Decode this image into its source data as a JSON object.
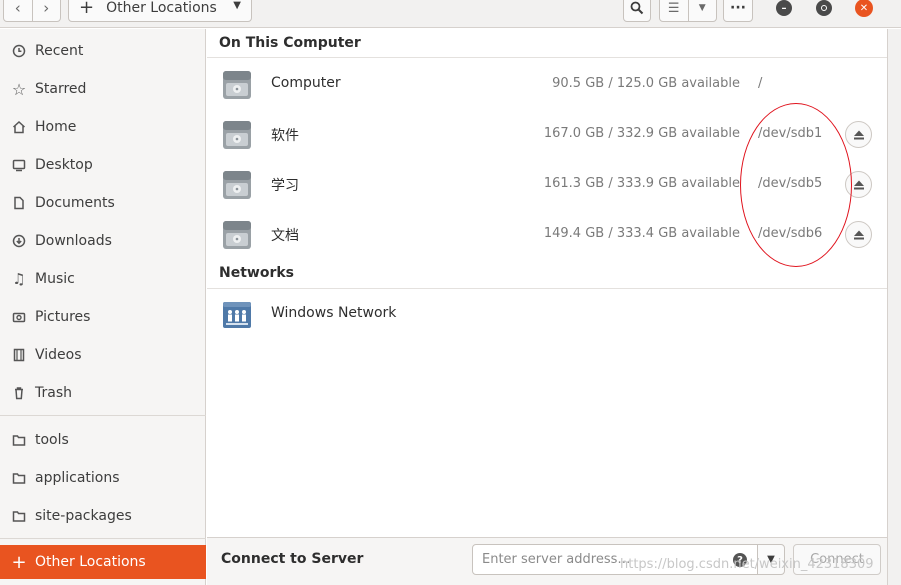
{
  "header": {
    "location_label": "Other Locations"
  },
  "sidebar": {
    "items": [
      {
        "label": "Recent",
        "icon": "clock-icon"
      },
      {
        "label": "Starred",
        "icon": "star-icon"
      },
      {
        "label": "Home",
        "icon": "home-icon"
      },
      {
        "label": "Desktop",
        "icon": "desktop-icon"
      },
      {
        "label": "Documents",
        "icon": "document-icon"
      },
      {
        "label": "Downloads",
        "icon": "download-icon"
      },
      {
        "label": "Music",
        "icon": "music-icon"
      },
      {
        "label": "Pictures",
        "icon": "camera-icon"
      },
      {
        "label": "Videos",
        "icon": "film-icon"
      },
      {
        "label": "Trash",
        "icon": "trash-icon"
      }
    ],
    "bookmarks": [
      {
        "label": "tools",
        "icon": "folder-icon"
      },
      {
        "label": "applications",
        "icon": "folder-icon"
      },
      {
        "label": "site-packages",
        "icon": "folder-icon"
      }
    ],
    "other_locations_label": "Other Locations",
    "accent_color": "#e95420"
  },
  "main": {
    "on_this_computer_title": "On This Computer",
    "drives": [
      {
        "name": "Computer",
        "space": "90.5 GB / 125.0 GB available",
        "mount": "/",
        "ejectable": false
      },
      {
        "name": "软件",
        "space": "167.0 GB / 332.9 GB available",
        "mount": "/dev/sdb1",
        "ejectable": true
      },
      {
        "name": "学习",
        "space": "161.3 GB / 333.9 GB available",
        "mount": "/dev/sdb5",
        "ejectable": true
      },
      {
        "name": "文档",
        "space": "149.4 GB / 333.4 GB available",
        "mount": "/dev/sdb6",
        "ejectable": true
      }
    ],
    "networks_title": "Networks",
    "networks": [
      {
        "name": "Windows Network"
      }
    ]
  },
  "connect": {
    "label": "Connect to Server",
    "placeholder": "Enter server address…",
    "button_label": "Connect"
  },
  "watermark": "https://blog.csdn.net/weixin_42318309"
}
